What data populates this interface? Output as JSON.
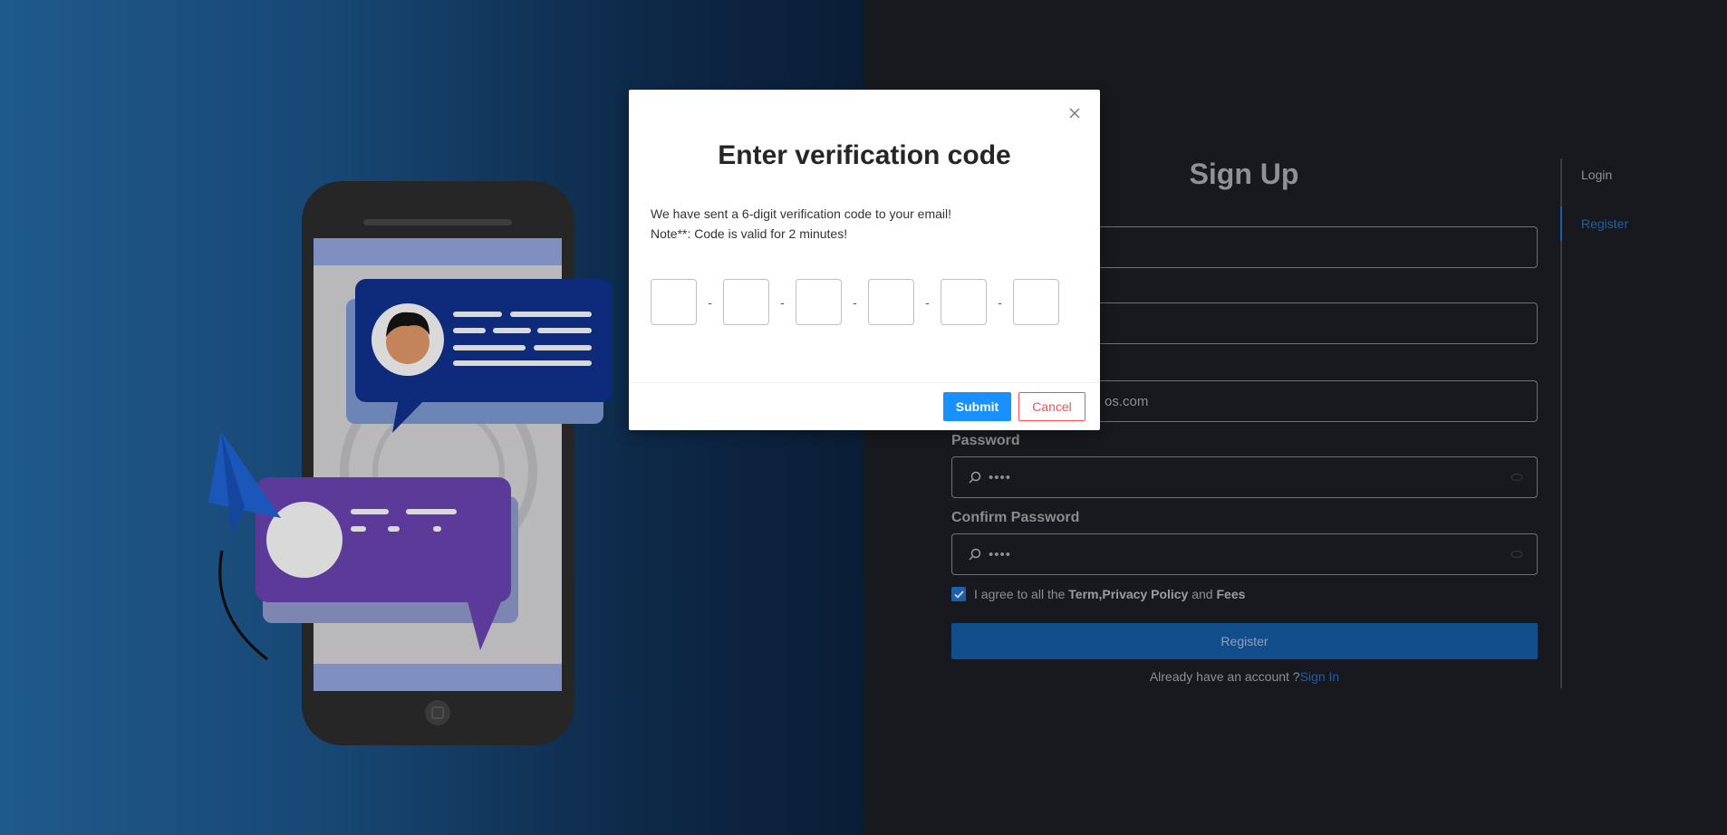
{
  "signup": {
    "title": "Sign Up",
    "email_partial": "os.com",
    "password_label": "Password",
    "password_value": "••••",
    "confirm_label": "Confirm Password",
    "confirm_value": "••••",
    "agree_prefix": "I agree to all the ",
    "agree_term": "Term",
    "agree_comma": " ,",
    "agree_privacy": "Privacy Policy",
    "agree_and": " and ",
    "agree_fees": "Fees",
    "agree_checked": true,
    "register_button": "Register",
    "already_text": "Already have an account ?",
    "sign_in_link": "Sign In"
  },
  "side_nav": {
    "items": [
      {
        "label": "Login",
        "active": false
      },
      {
        "label": "Register",
        "active": true
      }
    ]
  },
  "modal": {
    "title": "Enter verification code",
    "line1": "We have sent a 6-digit verification code to your email!",
    "line2": "Note**: Code is valid for 2 minutes!",
    "separator": "-",
    "code_digits": [
      "",
      "",
      "",
      "",
      "",
      ""
    ],
    "submit_label": "Submit",
    "cancel_label": "Cancel"
  },
  "colors": {
    "accent": "#1890ff",
    "cancel": "#ff4d4f",
    "link": "#1d5fa3"
  },
  "icons": {
    "close": "close-icon",
    "search": "search-icon",
    "eye": "eye-icon",
    "check": "check-icon"
  }
}
